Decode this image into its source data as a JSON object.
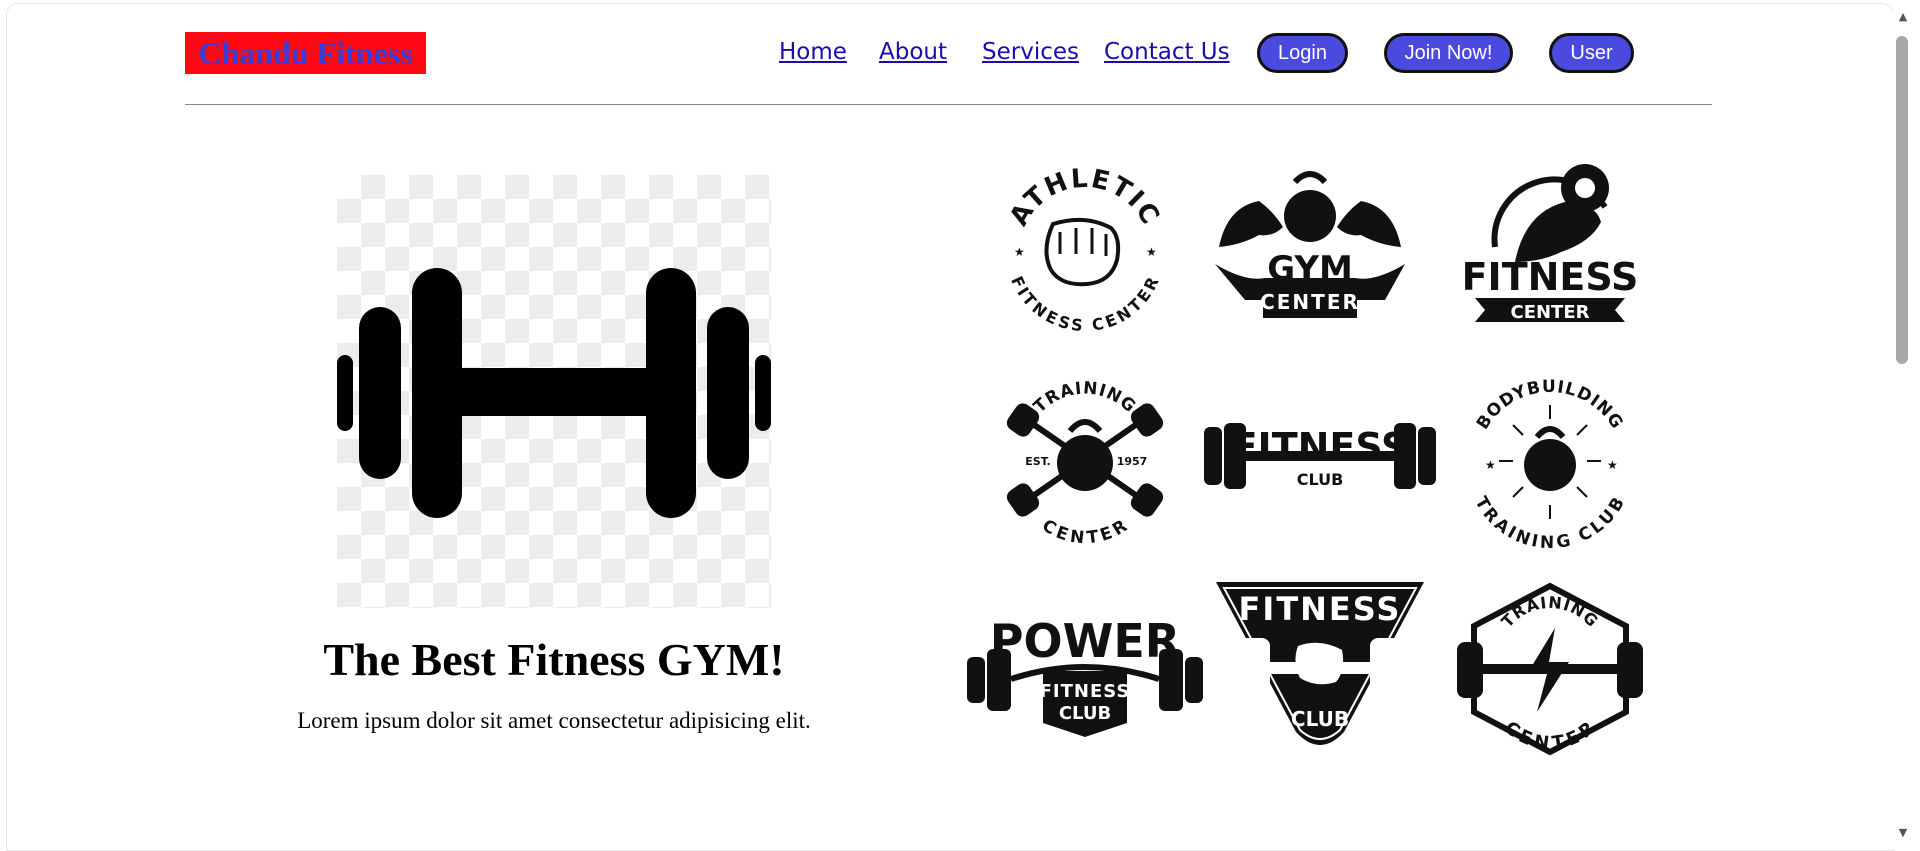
{
  "header": {
    "brand": "Chandu Fitness",
    "nav": [
      "Home",
      "About",
      "Services",
      "Contact Us"
    ],
    "buttons": [
      "Login",
      "Join Now!",
      "User"
    ]
  },
  "hero": {
    "title": "The Best Fitness GYM!",
    "subtitle": "Lorem ipsum dolor sit amet consectetur adipisicing elit."
  },
  "logos": [
    {
      "icon": "fist-icon",
      "text": [
        "ATHLETIC",
        "FITNESS CENTER"
      ]
    },
    {
      "icon": "flexing-arms-kettlebell-icon",
      "text": [
        "GYM",
        "CENTER"
      ]
    },
    {
      "icon": "bicep-dumbbell-icon",
      "text": [
        "FITNESS",
        "CENTER"
      ]
    },
    {
      "icon": "kettlebell-barbells-icon",
      "text": [
        "TRAINING",
        "EST.",
        "1957",
        "CENTER"
      ]
    },
    {
      "icon": "barbell-icon",
      "text": [
        "FITNESS",
        "CLUB"
      ]
    },
    {
      "icon": "kettlebell-sunburst-icon",
      "text": [
        "BODYBUILDING",
        "TRAINING CLUB"
      ]
    },
    {
      "icon": "barbell-banner-icon",
      "text": [
        "POWER",
        "FITNESS",
        "CLUB"
      ]
    },
    {
      "icon": "hand-dumbbell-icon",
      "text": [
        "FITNESS",
        "CLUB"
      ]
    },
    {
      "icon": "lightning-barbell-icon",
      "text": [
        "TRAINING",
        "CENTER"
      ]
    }
  ],
  "colors": {
    "brand_bg": "#ff0a14",
    "brand_text": "#3b3bd6",
    "button_bg": "#4a4adf",
    "link": "#1a0dab"
  }
}
